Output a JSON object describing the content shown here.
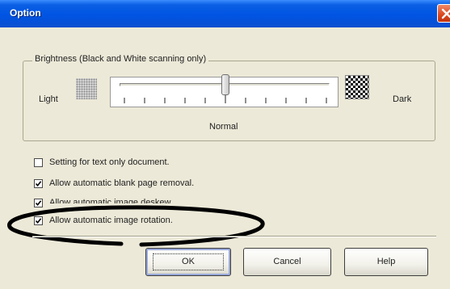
{
  "window": {
    "title": "Option"
  },
  "brightness": {
    "group_label": "Brightness (Black and White scanning only)",
    "light_label": "Light",
    "dark_label": "Dark",
    "position_label": "Normal",
    "slider_level": 0.5,
    "tick_count": 11
  },
  "options": [
    {
      "label": "Setting for text only document.",
      "checked": false
    },
    {
      "label": "Allow automatic blank page removal.",
      "checked": true
    },
    {
      "label": "Allow automatic image deskew.",
      "checked": true
    },
    {
      "label": "Allow automatic image rotation.",
      "checked": true
    }
  ],
  "buttons": {
    "ok": "OK",
    "cancel": "Cancel",
    "help": "Help"
  },
  "colors": {
    "titlebar": "#0054e3",
    "dialog_background": "#ece9d8",
    "close_button": "#d9471e",
    "highlight_ellipse": "#000000"
  },
  "icons": {
    "close": "close-icon",
    "check": "checkmark-icon"
  }
}
